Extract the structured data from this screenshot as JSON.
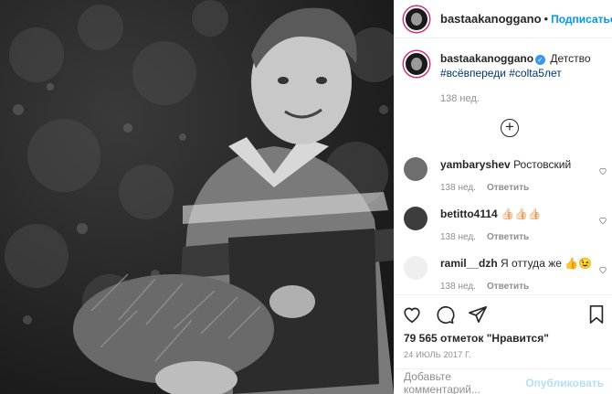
{
  "header": {
    "username": "bastaakanoggano",
    "separator": "•",
    "follow_label": "Подписаться"
  },
  "caption": {
    "username": "bastaakanoggano",
    "verified_mark": "✓",
    "text": "Детство",
    "hashtags": "#всёвпереди #colta5лет",
    "time": "138 нед."
  },
  "more_comments_icon": "plus-circle-icon",
  "comments": [
    {
      "username": "yambaryshev",
      "text": "Ростовский",
      "time": "138 нед.",
      "reply": "Ответить"
    },
    {
      "username": "betitto4114",
      "text": "👍🏻👍🏻👍🏻",
      "time": "138 нед.",
      "reply": "Ответить"
    },
    {
      "username": "ramil__dzh",
      "text": "Я оттуда же 👍😉",
      "time": "138 нед.",
      "reply": "Ответить"
    }
  ],
  "actions": {
    "likes": "79 565 отметок \"Нравится\"",
    "date": "24 ИЮЛЬ 2017 Г."
  },
  "add_comment": {
    "placeholder": "Добавьте комментарий...",
    "publish_label": "Опубликовать"
  },
  "colors": {
    "accent": "#0095f6",
    "muted": "#8e8e8e",
    "border": "#efefef"
  }
}
